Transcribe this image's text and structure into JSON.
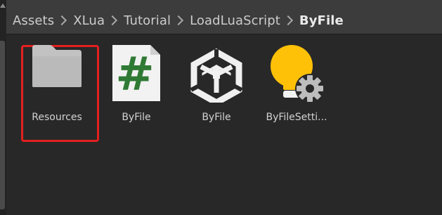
{
  "breadcrumb": {
    "items": [
      "Assets",
      "XLua",
      "Tutorial",
      "LoadLuaScript",
      "ByFile"
    ]
  },
  "grid": {
    "items": [
      {
        "label": "Resources",
        "icon": "folder-icon",
        "selected": true
      },
      {
        "label": "ByFile",
        "icon": "csharp-script-icon"
      },
      {
        "label": "ByFile",
        "icon": "unity-scene-icon"
      },
      {
        "label": "ByFileSetti...",
        "icon": "lightbulb-settings-icon"
      }
    ],
    "csharp_glyph": "#"
  },
  "colors": {
    "background": "#282828",
    "breadcrumb_bar": "#3c3c3c",
    "selection_highlight": "#e3201f",
    "folder": "#c2c2c2",
    "csharp_glyph": "#2f7a34",
    "lightbulb": "#ffc107"
  }
}
